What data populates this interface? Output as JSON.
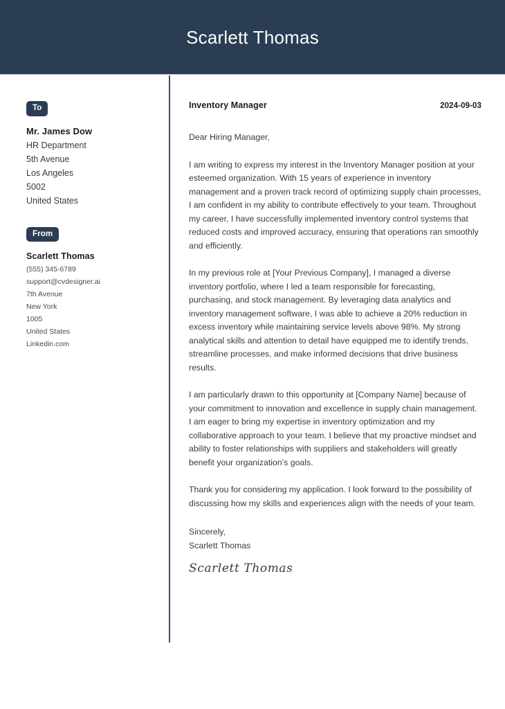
{
  "header": {
    "name": "Scarlett Thomas"
  },
  "sidebar": {
    "to": {
      "badge_label": "To",
      "name": "Mr. James Dow",
      "lines": [
        "HR Department",
        "5th Avenue",
        "Los Angeles",
        "5002",
        "United States"
      ]
    },
    "from": {
      "badge_label": "From",
      "name": "Scarlett Thomas",
      "lines": [
        "(555) 345-6789",
        "support@cvdesigner.ai",
        "7th Avenue",
        "New York",
        "1005",
        "United States",
        "Linkedin.com"
      ]
    }
  },
  "letter": {
    "job_title": "Inventory Manager",
    "date": "2024-09-03",
    "salutation": "Dear Hiring Manager,",
    "paragraphs": [
      "I am writing to express my interest in the Inventory Manager position at your esteemed organization. With 15 years of experience in inventory management and a proven track record of optimizing supply chain processes, I am confident in my ability to contribute effectively to your team. Throughout my career, I have successfully implemented inventory control systems that reduced costs and improved accuracy, ensuring that operations ran smoothly and efficiently.",
      "In my previous role at [Your Previous Company], I managed a diverse inventory portfolio, where I led a team responsible for forecasting, purchasing, and stock management. By leveraging data analytics and inventory management software, I was able to achieve a 20% reduction in excess inventory while maintaining service levels above 98%. My strong analytical skills and attention to detail have equipped me to identify trends, streamline processes, and make informed decisions that drive business results.",
      "I am particularly drawn to this opportunity at [Company Name] because of your commitment to innovation and excellence in supply chain management. I am eager to bring my expertise in inventory optimization and my collaborative approach to your team. I believe that my proactive mindset and ability to foster relationships with suppliers and stakeholders will greatly benefit your organization’s goals.",
      "Thank you for considering my application. I look forward to the possibility of discussing how my skills and experiences align with the needs of your team."
    ],
    "closing_salutation": "Sincerely,",
    "closing_name": "Scarlett Thomas",
    "signature": "Scarlett Thomas"
  },
  "colors": {
    "banner": "#2a3d53",
    "badge": "#2a3d53",
    "divider": "#3c5067",
    "body_text": "#3a3a3a",
    "heading_text": "#1c1c1c"
  }
}
